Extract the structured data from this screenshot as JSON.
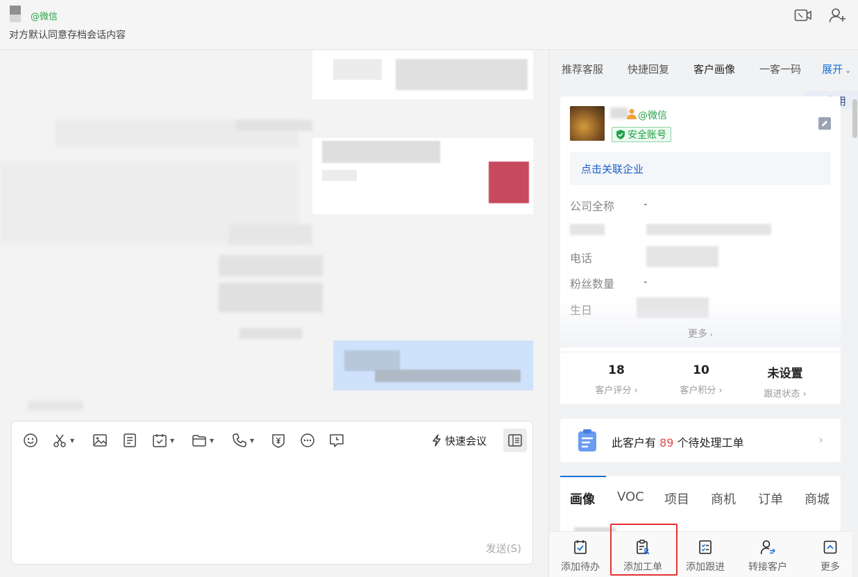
{
  "header": {
    "source_tag": "@微信",
    "consent_text": "对方默认同意存档会话内容",
    "video_call_icon": "video-call-icon",
    "add_member_icon": "add-member-icon"
  },
  "editor": {
    "quick_meeting_label": "快速会议",
    "send_label": "发送(S)",
    "tools": [
      "emoji-icon",
      "scissors-icon",
      "image-icon",
      "document-icon",
      "schedule-icon",
      "folder-icon",
      "phone-icon",
      "red-packet-icon",
      "more-icon",
      "feedback-icon"
    ]
  },
  "right_panel": {
    "tabs": [
      {
        "label": "推荐客服"
      },
      {
        "label": "快捷回复"
      },
      {
        "label": "客户画像"
      },
      {
        "label": "一客一码"
      }
    ],
    "expand_label": "展开",
    "apps_label": "应用",
    "profile": {
      "wx_tag": "@微信",
      "safe_badge": "安全账号",
      "link_company": "点击关联企业",
      "fields": [
        {
          "label": "公司全称",
          "value": "-"
        },
        {
          "label": "电话",
          "value": ""
        },
        {
          "label": "粉丝数量",
          "value": "-"
        },
        {
          "label": "生日",
          "value": ""
        }
      ],
      "more_label": "更多",
      "stats": [
        {
          "value": "18",
          "label": "客户评分"
        },
        {
          "value": "10",
          "label": "客户积分"
        },
        {
          "value": "未设置",
          "label": "跟进状态"
        }
      ]
    },
    "tickets": {
      "prefix": "此客户有 ",
      "count": "89",
      "suffix": " 个待处理工单"
    },
    "detail_tabs": [
      "画像",
      "VOC",
      "项目",
      "商机",
      "订单",
      "商城"
    ],
    "actions": [
      {
        "label": "添加待办",
        "icon": "todo-check-icon"
      },
      {
        "label": "添加工单",
        "icon": "ticket-add-icon"
      },
      {
        "label": "添加跟进",
        "icon": "follow-up-icon"
      },
      {
        "label": "转接客户",
        "icon": "transfer-user-icon"
      },
      {
        "label": "更多",
        "icon": "more-up-icon"
      }
    ],
    "colors": {
      "accent": "#1a6fd8",
      "wechat_green": "#2ba24c",
      "danger": "#e04848",
      "highlight": "#e5322d"
    }
  }
}
